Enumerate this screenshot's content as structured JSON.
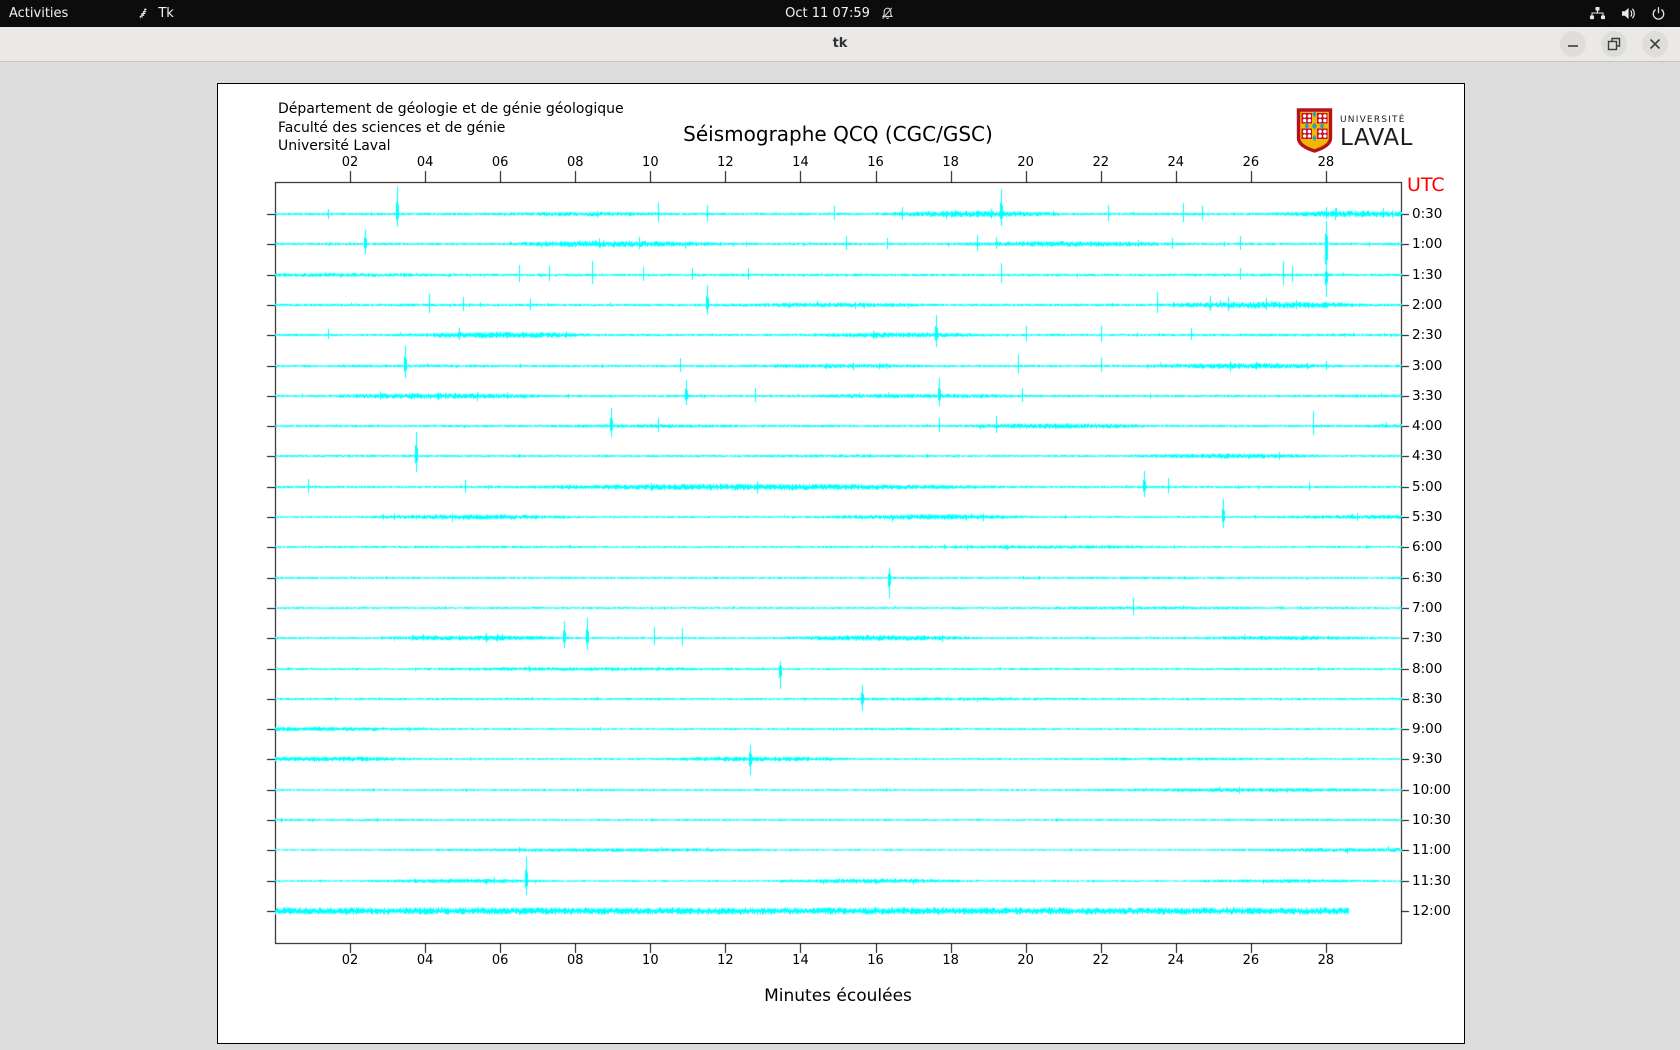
{
  "top_bar": {
    "activities": "Activities",
    "app_name": "Tk",
    "clock": "Oct 11 07:59",
    "status_icons": [
      "notifications-disabled-icon",
      "network-icon",
      "volume-icon",
      "power-icon"
    ]
  },
  "window": {
    "title": "tk",
    "controls": [
      "minimize",
      "maximize",
      "close"
    ]
  },
  "header": {
    "address_lines": [
      "Département de géologie et de génie géologique",
      "Faculté des sciences et de génie",
      "Université Laval"
    ],
    "logo": {
      "line1": "UNIVERSITÉ",
      "line2": "LAVAL"
    }
  },
  "chart_data": {
    "type": "seismogram",
    "title": "Séismographe QCQ (CGC/GSC)",
    "station": "QCQ (CGC/GSC)",
    "xlabel": "Minutes écoulées",
    "utc_label": "UTC",
    "x_ticks": [
      "02",
      "04",
      "06",
      "08",
      "10",
      "12",
      "14",
      "16",
      "18",
      "20",
      "22",
      "24",
      "26",
      "28"
    ],
    "x_range_minutes": [
      0,
      30
    ],
    "minutes_per_line": 30,
    "trace_color": "#00ffff",
    "utc_color": "#ff0000",
    "spike_format": "[minute, up_px, down_px]",
    "rows": [
      {
        "time": "0:30",
        "noise": 1.8,
        "spikes": [
          [
            1.4,
            5,
            5
          ],
          [
            3.24,
            27,
            13
          ],
          [
            10.2,
            11,
            8
          ],
          [
            11.5,
            9,
            7
          ],
          [
            14.9,
            8,
            6
          ],
          [
            16.7,
            7,
            6
          ],
          [
            19.35,
            25,
            12
          ],
          [
            22.2,
            9,
            7
          ],
          [
            24.2,
            11,
            8
          ],
          [
            24.7,
            8,
            6
          ],
          [
            28.0,
            7,
            5
          ]
        ]
      },
      {
        "time": "1:00",
        "noise": 1.8,
        "spikes": [
          [
            2.4,
            15,
            10
          ],
          [
            9.7,
            7,
            5
          ],
          [
            15.2,
            8,
            6
          ],
          [
            16.3,
            6,
            5
          ],
          [
            18.7,
            9,
            7
          ],
          [
            19.2,
            7,
            5
          ],
          [
            23.9,
            6,
            5
          ],
          [
            25.7,
            8,
            6
          ],
          [
            28.0,
            23,
            45
          ]
        ]
      },
      {
        "time": "1:30",
        "noise": 1.8,
        "spikes": [
          [
            6.5,
            10,
            7
          ],
          [
            7.3,
            9,
            6
          ],
          [
            8.45,
            14,
            9
          ],
          [
            9.8,
            8,
            6
          ],
          [
            11.1,
            7,
            5
          ],
          [
            12.6,
            7,
            5
          ],
          [
            19.35,
            12,
            8
          ],
          [
            25.7,
            7,
            5
          ],
          [
            26.85,
            14,
            10
          ],
          [
            27.1,
            9,
            7
          ],
          [
            28.0,
            8,
            22
          ]
        ]
      },
      {
        "time": "2:00",
        "noise": 1.8,
        "spikes": [
          [
            4.1,
            12,
            8
          ],
          [
            5.0,
            8,
            6
          ],
          [
            6.8,
            6,
            5
          ],
          [
            11.5,
            20,
            10
          ],
          [
            23.5,
            13,
            8
          ],
          [
            24.9,
            9,
            6
          ],
          [
            25.4,
            8,
            6
          ],
          [
            26.4,
            7,
            5
          ]
        ]
      },
      {
        "time": "2:30",
        "noise": 1.7,
        "spikes": [
          [
            1.4,
            6,
            4
          ],
          [
            4.9,
            7,
            5
          ],
          [
            17.6,
            20,
            12
          ],
          [
            20.0,
            9,
            6
          ],
          [
            22.0,
            10,
            7
          ],
          [
            24.4,
            7,
            5
          ]
        ]
      },
      {
        "time": "3:00",
        "noise": 1.7,
        "spikes": [
          [
            3.47,
            20,
            12
          ],
          [
            10.8,
            8,
            6
          ],
          [
            19.8,
            11,
            7
          ],
          [
            22.0,
            9,
            6
          ],
          [
            28.0,
            5,
            4
          ]
        ]
      },
      {
        "time": "3:30",
        "noise": 1.7,
        "spikes": [
          [
            10.95,
            16,
            9
          ],
          [
            12.8,
            8,
            6
          ],
          [
            17.7,
            18,
            10
          ],
          [
            19.9,
            8,
            6
          ]
        ]
      },
      {
        "time": "4:00",
        "noise": 1.7,
        "spikes": [
          [
            8.94,
            18,
            11
          ],
          [
            10.2,
            8,
            6
          ],
          [
            17.7,
            8,
            6
          ],
          [
            19.2,
            10,
            7
          ],
          [
            27.65,
            15,
            9
          ]
        ]
      },
      {
        "time": "4:30",
        "noise": 1.6,
        "spikes": [
          [
            3.75,
            24,
            16
          ]
        ]
      },
      {
        "time": "5:00",
        "noise": 1.7,
        "spikes": [
          [
            0.87,
            8,
            6
          ],
          [
            5.06,
            7,
            6
          ],
          [
            23.15,
            16,
            10
          ],
          [
            23.8,
            9,
            6
          ],
          [
            27.55,
            5,
            4
          ]
        ]
      },
      {
        "time": "5:30",
        "noise": 1.5,
        "spikes": [
          [
            25.25,
            18,
            11
          ]
        ]
      },
      {
        "time": "6:00",
        "noise": 1.5,
        "spikes": []
      },
      {
        "time": "6:30",
        "noise": 1.5,
        "spikes": [
          [
            16.35,
            10,
            20
          ]
        ]
      },
      {
        "time": "7:00",
        "noise": 1.5,
        "spikes": [
          [
            22.85,
            11,
            7
          ]
        ]
      },
      {
        "time": "7:30",
        "noise": 1.5,
        "spikes": [
          [
            7.7,
            17,
            10
          ],
          [
            8.3,
            20,
            12
          ],
          [
            10.1,
            11,
            7
          ],
          [
            10.85,
            10,
            7
          ]
        ]
      },
      {
        "time": "8:00",
        "noise": 1.5,
        "spikes": [
          [
            13.45,
            8,
            20
          ]
        ]
      },
      {
        "time": "8:30",
        "noise": 1.5,
        "spikes": [
          [
            15.65,
            14,
            12
          ]
        ]
      },
      {
        "time": "9:00",
        "noise": 1.4,
        "spikes": []
      },
      {
        "time": "9:30",
        "noise": 1.4,
        "spikes": [
          [
            12.65,
            14,
            16
          ]
        ]
      },
      {
        "time": "10:00",
        "noise": 1.4,
        "spikes": []
      },
      {
        "time": "10:30",
        "noise": 1.4,
        "spikes": []
      },
      {
        "time": "11:00",
        "noise": 1.3,
        "spikes": []
      },
      {
        "time": "11:30",
        "noise": 1.3,
        "spikes": [
          [
            6.7,
            24,
            14
          ]
        ]
      },
      {
        "time": "12:00",
        "noise": 2.4,
        "flat": true,
        "end_minute": 28.6,
        "spikes": []
      }
    ]
  }
}
